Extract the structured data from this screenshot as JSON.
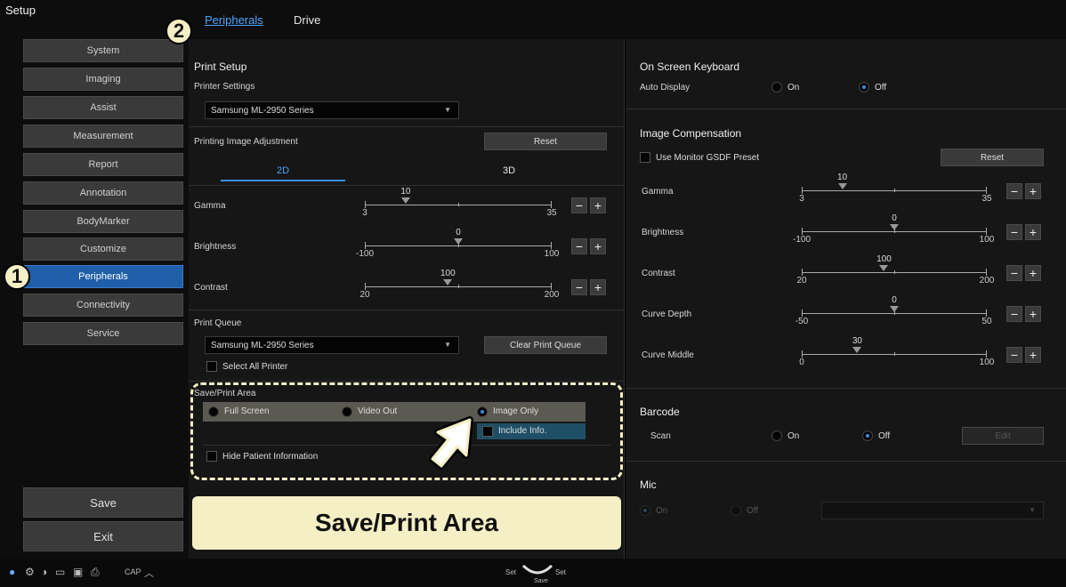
{
  "app": {
    "title": "Setup"
  },
  "sidebar": {
    "items": [
      {
        "label": "System"
      },
      {
        "label": "Imaging"
      },
      {
        "label": "Assist"
      },
      {
        "label": "Measurement"
      },
      {
        "label": "Report"
      },
      {
        "label": "Annotation"
      },
      {
        "label": "BodyMarker"
      },
      {
        "label": "Customize"
      },
      {
        "label": "Peripherals",
        "active": true
      },
      {
        "label": "Connectivity"
      },
      {
        "label": "Service"
      }
    ],
    "save_label": "Save",
    "exit_label": "Exit"
  },
  "callouts": {
    "one": "1",
    "two": "2"
  },
  "tabs": [
    {
      "label": "Peripherals",
      "active": true
    },
    {
      "label": "Drive"
    }
  ],
  "print_setup": {
    "title": "Print Setup",
    "printer_settings_label": "Printer Settings",
    "printer_value": "Samsung ML-2950 Series",
    "adjustment_label": "Printing Image Adjustment",
    "reset_label": "Reset",
    "subtabs": [
      "2D",
      "3D"
    ],
    "sliders": {
      "gamma": {
        "label": "Gamma",
        "value": "10",
        "min": "3",
        "max": "35",
        "v": 10,
        "lo": 3,
        "hi": 35
      },
      "brightness": {
        "label": "Brightness",
        "value": "0",
        "min": "-100",
        "max": "100",
        "v": 0,
        "lo": -100,
        "hi": 100
      },
      "contrast": {
        "label": "Contrast",
        "value": "100",
        "min": "20",
        "max": "200",
        "v": 100,
        "lo": 20,
        "hi": 200
      }
    },
    "queue_label": "Print Queue",
    "queue_value": "Samsung ML-2950 Series",
    "clear_queue_label": "Clear Print Queue",
    "select_all_label": "Select All Printer",
    "save_print_area_label": "Save/Print Area",
    "area_options": [
      "Full Screen",
      "Video Out",
      "Image Only"
    ],
    "include_info_label": "Include Info.",
    "hide_patient_label": "Hide Patient Information"
  },
  "caption": "Save/Print Area",
  "right": {
    "osk_title": "On Screen Keyboard",
    "auto_display_label": "Auto Display",
    "on_label": "On",
    "off_label": "Off",
    "comp_title": "Image Compensation",
    "gsdf_label": "Use Monitor GSDF Preset",
    "reset_label": "Reset",
    "sliders": {
      "gamma": {
        "label": "Gamma",
        "value": "10",
        "min": "3",
        "max": "35",
        "v": 10,
        "lo": 3,
        "hi": 35
      },
      "brightness": {
        "label": "Brightness",
        "value": "0",
        "min": "-100",
        "max": "100",
        "v": 0,
        "lo": -100,
        "hi": 100
      },
      "contrast": {
        "label": "Contrast",
        "value": "100",
        "min": "20",
        "max": "200",
        "v": 100,
        "lo": 20,
        "hi": 200
      },
      "curve_depth": {
        "label": "Curve Depth",
        "value": "0",
        "min": "-50",
        "max": "50",
        "v": 0,
        "lo": -50,
        "hi": 50
      },
      "curve_middle": {
        "label": "Curve Middle",
        "value": "30",
        "min": "0",
        "max": "100",
        "v": 30,
        "lo": 0,
        "hi": 100
      }
    },
    "barcode_title": "Barcode",
    "scan_label": "Scan",
    "edit_label": "Edit",
    "mic_title": "Mic"
  },
  "status_bar": {
    "cap_label": "CAP",
    "set_left": "Set",
    "set_right": "Set",
    "save_small": "Save"
  }
}
